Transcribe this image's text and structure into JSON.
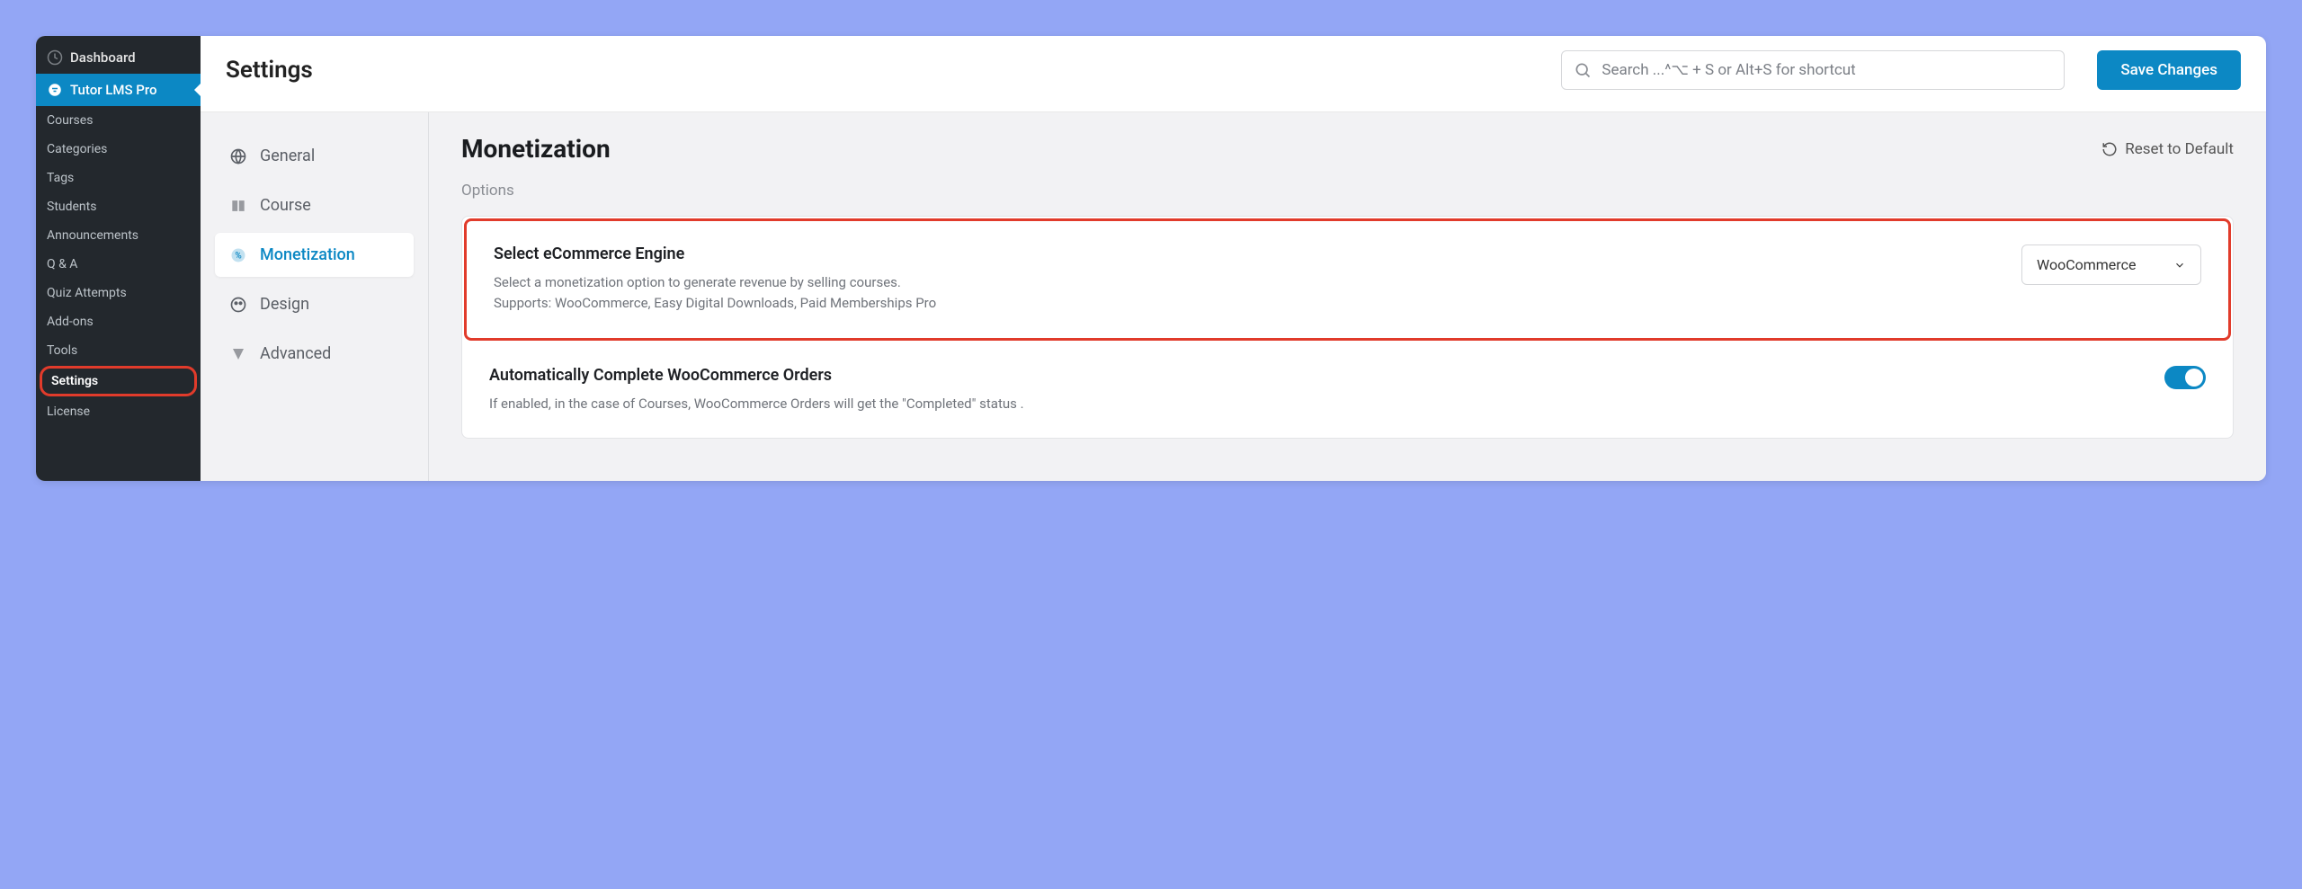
{
  "wp_sidebar": {
    "dashboard": "Dashboard",
    "plugin": "Tutor LMS Pro",
    "items": [
      "Courses",
      "Categories",
      "Tags",
      "Students",
      "Announcements",
      "Q & A",
      "Quiz Attempts",
      "Add-ons",
      "Tools",
      "Settings",
      "License"
    ],
    "selected": "Settings"
  },
  "header": {
    "title": "Settings",
    "search_placeholder": "Search ...^⌥ + S or Alt+S for shortcut",
    "save_label": "Save Changes"
  },
  "tabs": [
    {
      "label": "General"
    },
    {
      "label": "Course"
    },
    {
      "label": "Monetization",
      "active": true
    },
    {
      "label": "Design"
    },
    {
      "label": "Advanced"
    }
  ],
  "panel": {
    "title": "Monetization",
    "reset_label": "Reset to Default",
    "options_label": "Options",
    "rows": [
      {
        "title": "Select eCommerce Engine",
        "desc": "Select a monetization option to generate revenue by selling courses.\nSupports: WooCommerce, Easy Digital Downloads, Paid Memberships Pro",
        "control": {
          "type": "select",
          "value": "WooCommerce"
        },
        "highlight": true
      },
      {
        "title": "Automatically Complete WooCommerce Orders",
        "desc": "If enabled, in the case of Courses, WooCommerce Orders will get the \"Completed\" status .",
        "control": {
          "type": "toggle",
          "on": true
        }
      }
    ]
  }
}
